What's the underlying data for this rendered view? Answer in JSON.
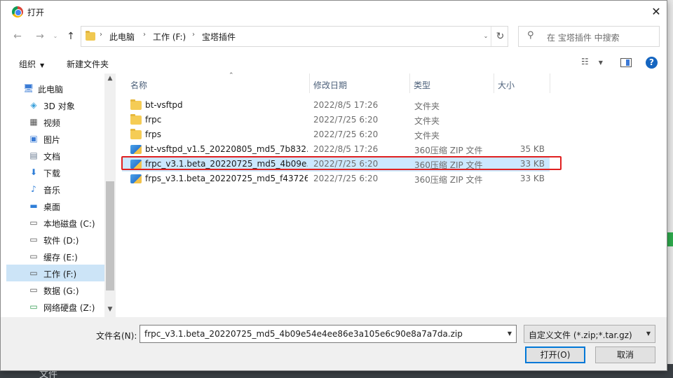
{
  "dialog": {
    "title": "打开",
    "close_label": "✕"
  },
  "nav": {
    "back": "←",
    "forward": "→",
    "recent": "⌄",
    "up": "↑",
    "breadcrumbs": [
      "此电脑",
      "工作 (F:)",
      "宝塔插件"
    ],
    "refresh": "↻",
    "search_placeholder": "在 宝塔插件 中搜索"
  },
  "toolbar": {
    "organize": "组织",
    "new_folder": "新建文件夹",
    "help": "?"
  },
  "sidebar": {
    "items": [
      {
        "label": "此电脑",
        "icon": "computer-icon"
      },
      {
        "label": "3D 对象",
        "icon": "cube-icon"
      },
      {
        "label": "视频",
        "icon": "video-icon"
      },
      {
        "label": "图片",
        "icon": "picture-icon"
      },
      {
        "label": "文档",
        "icon": "document-icon"
      },
      {
        "label": "下载",
        "icon": "download-icon"
      },
      {
        "label": "音乐",
        "icon": "music-icon"
      },
      {
        "label": "桌面",
        "icon": "desktop-icon"
      },
      {
        "label": "本地磁盘 (C:)",
        "icon": "drive-icon"
      },
      {
        "label": "软件 (D:)",
        "icon": "drive-icon"
      },
      {
        "label": "缓存 (E:)",
        "icon": "drive-icon"
      },
      {
        "label": "工作 (F:)",
        "icon": "drive-icon"
      },
      {
        "label": "数据 (G:)",
        "icon": "drive-icon"
      },
      {
        "label": "网络硬盘 (Z:)",
        "icon": "network-drive-icon"
      }
    ],
    "selected_index": 11
  },
  "columns": {
    "name": "名称",
    "date": "修改日期",
    "type": "类型",
    "size": "大小"
  },
  "files": [
    {
      "name": "bt-vsftpd",
      "date": "2022/8/5 17:26",
      "type": "文件夹",
      "size": "",
      "kind": "folder"
    },
    {
      "name": "frpc",
      "date": "2022/7/25 6:20",
      "type": "文件夹",
      "size": "",
      "kind": "folder"
    },
    {
      "name": "frps",
      "date": "2022/7/25 6:20",
      "type": "文件夹",
      "size": "",
      "kind": "folder"
    },
    {
      "name": "bt-vsftpd_v1.5_20220805_md5_7b832...",
      "date": "2022/8/5 17:26",
      "type": "360压缩 ZIP 文件",
      "size": "35 KB",
      "kind": "zip"
    },
    {
      "name": "frpc_v3.1.beta_20220725_md5_4b09e...",
      "date": "2022/7/25 6:20",
      "type": "360压缩 ZIP 文件",
      "size": "33 KB",
      "kind": "zip"
    },
    {
      "name": "frps_v3.1.beta_20220725_md5_f43726...",
      "date": "2022/7/25 6:20",
      "type": "360压缩 ZIP 文件",
      "size": "33 KB",
      "kind": "zip"
    }
  ],
  "selected_file_index": 4,
  "bottom": {
    "filename_label": "文件名(N):",
    "filename_value": "frpc_v3.1.beta_20220725_md5_4b09e54e4ee86e3a105e6c90e8a7a7da.zip",
    "filetype_value": "自定义文件 (*.zip;*.tar.gz)",
    "open_label": "打开(O)",
    "cancel_label": "取消"
  },
  "background": {
    "bottom_text": "文件"
  },
  "colors": {
    "selection": "#cce8ff",
    "highlight_box": "#e02020",
    "primary_border": "#0078d7"
  }
}
